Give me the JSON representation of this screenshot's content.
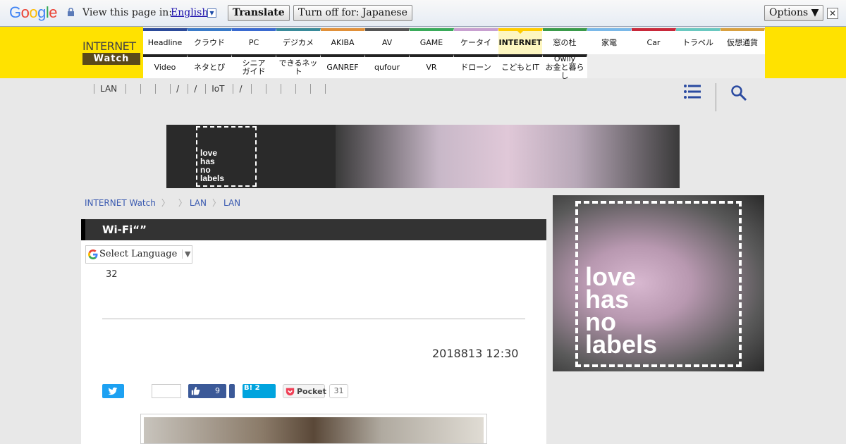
{
  "translate_bar": {
    "logo": "Google",
    "view_label": "View this page in:",
    "language": "English",
    "translate_button": "Translate",
    "turn_off_button": "Turn off for: Japanese",
    "options_button": "Options ▼",
    "close": "✕"
  },
  "logo": {
    "top": "INTERNET",
    "bottom": "Watch"
  },
  "nav": {
    "row1": [
      {
        "label": "Headline",
        "color": "#2b4a9a"
      },
      {
        "label": "クラウド",
        "color": "#3a7ac8"
      },
      {
        "label": "PC",
        "color": "#3a6ad0"
      },
      {
        "label": "デジカメ",
        "color": "#3a8a9a"
      },
      {
        "label": "AKIBA",
        "color": "#e0903a"
      },
      {
        "label": "AV",
        "color": "#555555"
      },
      {
        "label": "GAME",
        "color": "#3aaa5a"
      },
      {
        "label": "ケータイ",
        "color": "#c8a0d0"
      },
      {
        "label": "INTERNET",
        "color": "#ffcc00",
        "active": true
      },
      {
        "label": "窓の杜",
        "color": "#3a9a4a"
      },
      {
        "label": "家電",
        "color": "#7ab8e8"
      },
      {
        "label": "Car",
        "color": "#c8283a"
      },
      {
        "label": "トラベル",
        "color": "#6ac8c0"
      },
      {
        "label": "仮想通貨",
        "color": "#d8a040"
      }
    ],
    "row2": [
      {
        "label": "Video",
        "color": "#222222"
      },
      {
        "label": "ネタとぴ",
        "color": "#222222"
      },
      {
        "label": "シニア\nガイド",
        "color": "#222222"
      },
      {
        "label": "できるネット",
        "color": "#222222"
      },
      {
        "label": "GANREF",
        "color": "#222222"
      },
      {
        "label": "qufour",
        "color": "#222222"
      },
      {
        "label": "VR",
        "color": "#222222"
      },
      {
        "label": "ドローン",
        "color": "#222222"
      },
      {
        "label": "こどもとIT",
        "color": "#222222"
      },
      {
        "label": "Owlly\nお金と暮らし",
        "color": "#222222"
      }
    ]
  },
  "subnav": [
    "LAN",
    "",
    "",
    "",
    "/",
    "/",
    "IoT",
    "/",
    "",
    "",
    "",
    "",
    "",
    ""
  ],
  "breadcrumb": [
    "INTERNET Watch",
    "",
    "LAN",
    "LAN"
  ],
  "article": {
    "title": "Wi-Fi“”",
    "lang_select": "Select Language",
    "count_text": "32",
    "date": "2018813 12:30",
    "fb_count": "9",
    "hatena_label": "B! 2",
    "pocket_label": "Pocket",
    "pocket_count": "31"
  },
  "ads": {
    "banner_lines": [
      "love",
      "has",
      "no",
      "labels"
    ],
    "side_lines": [
      "love",
      "has",
      "no",
      "labels"
    ]
  }
}
